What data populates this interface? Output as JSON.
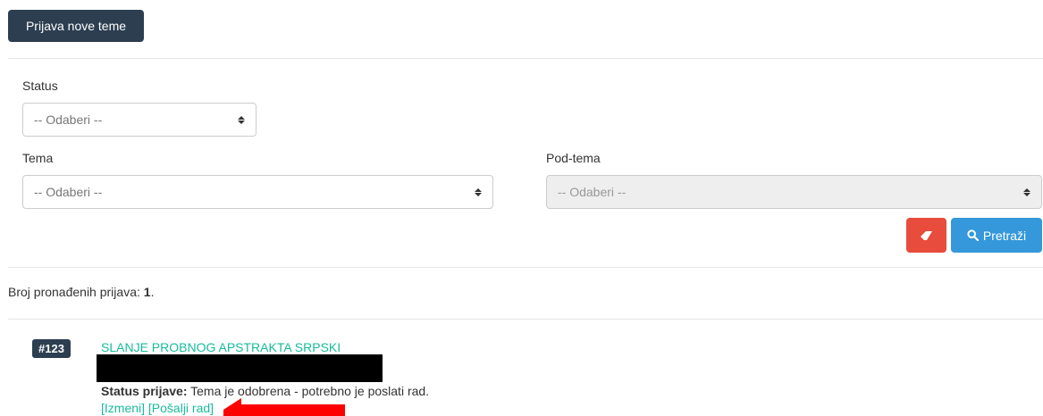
{
  "toolbar": {
    "new_topic_label": "Prijava nove teme"
  },
  "filters": {
    "status": {
      "label": "Status",
      "selected": "-- Odaberi --"
    },
    "tema": {
      "label": "Tema",
      "selected": "-- Odaberi --"
    },
    "podtema": {
      "label": "Pod-tema",
      "selected": "-- Odaberi --",
      "disabled": true
    },
    "clear_icon": "eraser-icon",
    "search_label": "Pretraži",
    "search_icon": "search-icon"
  },
  "results": {
    "count_label": "Broj pronađenih prijava:",
    "count_value": "1",
    "count_suffix": ".",
    "items": [
      {
        "badge": "#123",
        "title": "SLANJE PROBNOG APSTRAKTA SRPSKI",
        "status_label": "Status prijave:",
        "status_value": "Tema je odobrena - potrebno je poslati rad.",
        "edit_link": "[Izmeni]",
        "send_link": "[Pošalji rad]"
      }
    ]
  },
  "colors": {
    "dark": "#2c3e50",
    "danger": "#e74c3c",
    "info": "#3498db",
    "link": "#18bc9c",
    "annotation_arrow": "#ff0000"
  }
}
